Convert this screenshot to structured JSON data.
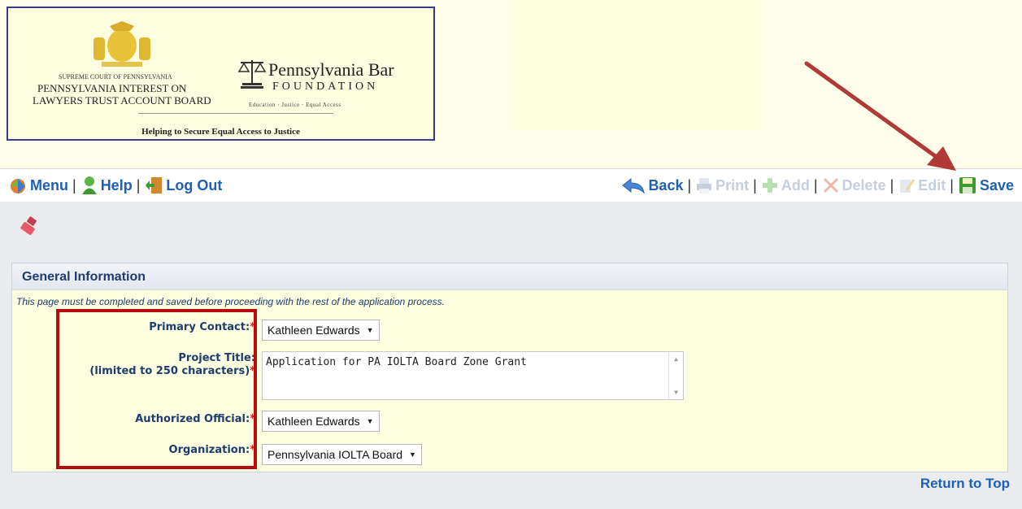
{
  "banner": {
    "court_small": "SUPREME COURT OF PENNSYLVANIA",
    "board_line1": "PENNSYLVANIA INTEREST ON",
    "board_line2": "LAWYERS TRUST ACCOUNT BOARD",
    "foundation_name": "Pennsylvania Bar",
    "foundation_word": "FOUNDATION",
    "foundation_tagline": "Education · Justice · Equal Access",
    "tagline": "Helping to Secure Equal Access to Justice"
  },
  "toolbar": {
    "left": [
      {
        "label": "Menu",
        "icon": "menu-icon"
      },
      {
        "label": "Help",
        "icon": "help-icon"
      },
      {
        "label": "Log Out",
        "icon": "logout-icon"
      }
    ],
    "right": [
      {
        "label": "Back",
        "icon": "back-icon",
        "enabled": true
      },
      {
        "label": "Print",
        "icon": "print-icon",
        "enabled": false
      },
      {
        "label": "Add",
        "icon": "add-icon",
        "enabled": false
      },
      {
        "label": "Delete",
        "icon": "delete-icon",
        "enabled": false
      },
      {
        "label": "Edit",
        "icon": "edit-icon",
        "enabled": false
      },
      {
        "label": "Save",
        "icon": "save-icon",
        "enabled": true
      }
    ],
    "separator": "|"
  },
  "section": {
    "title": "General Information",
    "note": "This page must be completed and saved before proceeding with the rest of the application process."
  },
  "form": {
    "primary_contact_label": "Primary Contact:",
    "primary_contact_value": "Kathleen Edwards",
    "project_title_label": "Project Title:",
    "project_title_sublabel": "(limited to 250 characters)",
    "project_title_value": "Application for PA IOLTA Board Zone Grant",
    "authorized_official_label": "Authorized Official:",
    "authorized_official_value": "Kathleen Edwards",
    "organization_label": "Organization:",
    "organization_value": "Pennsylvania IOLTA Board",
    "required_mark": "*"
  },
  "footer": {
    "return_to_top": "Return to Top"
  },
  "colors": {
    "link_blue": "#1f5fb5",
    "label_navy": "#1e3c6e",
    "required_red": "#d42020",
    "highlight_box": "#b50d0d",
    "arrow": "#b03a35"
  }
}
